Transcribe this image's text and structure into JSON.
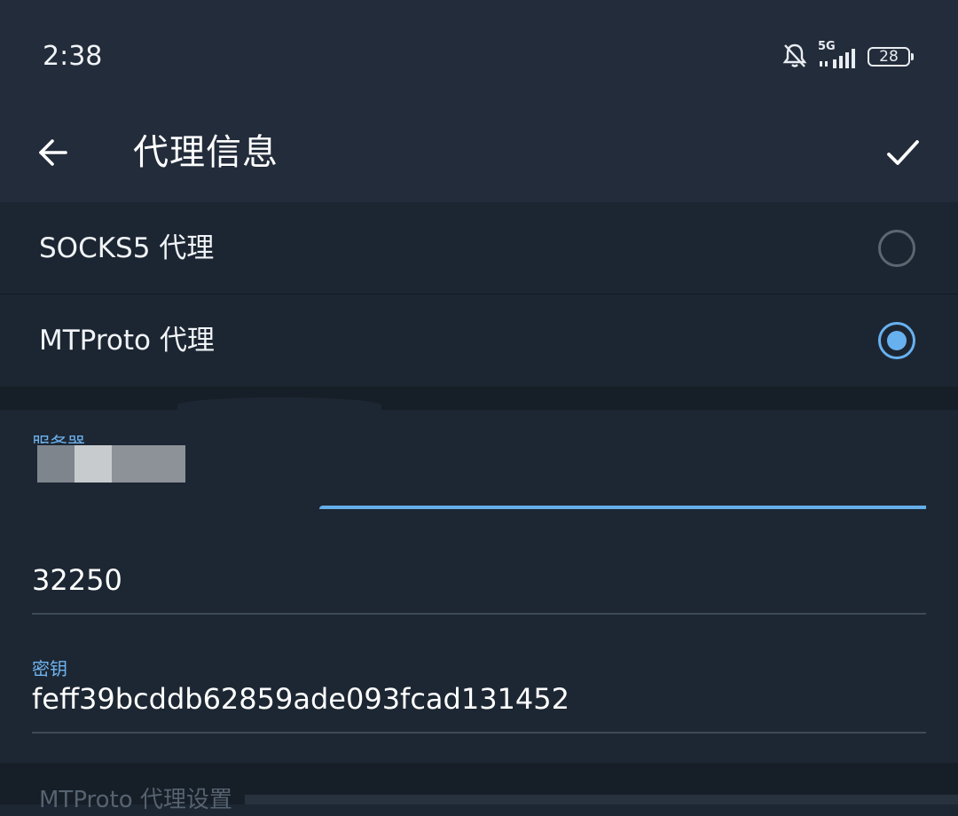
{
  "status_bar": {
    "time": "2:38",
    "network": "5G",
    "battery": "28",
    "icons": [
      "bell-off-icon",
      "signal-icon",
      "battery-icon"
    ]
  },
  "app_bar": {
    "title": "代理信息",
    "back_icon": "arrow-left-icon",
    "done_icon": "check-icon"
  },
  "proxy_types": [
    {
      "label": "SOCKS5 代理",
      "selected": false
    },
    {
      "label": "MTProto 代理",
      "selected": true
    }
  ],
  "fields": {
    "server": {
      "hint": "服务器",
      "value": ""
    },
    "port": {
      "value": "32250"
    },
    "secret": {
      "hint": "密钥",
      "value": "feff39bcddb62859ade093fcad131452"
    }
  },
  "footer": {
    "section_title": "MTProto 代理设置"
  },
  "colors": {
    "accent": "#68b1ef",
    "background": "#1d2733",
    "header": "#232c3a"
  }
}
